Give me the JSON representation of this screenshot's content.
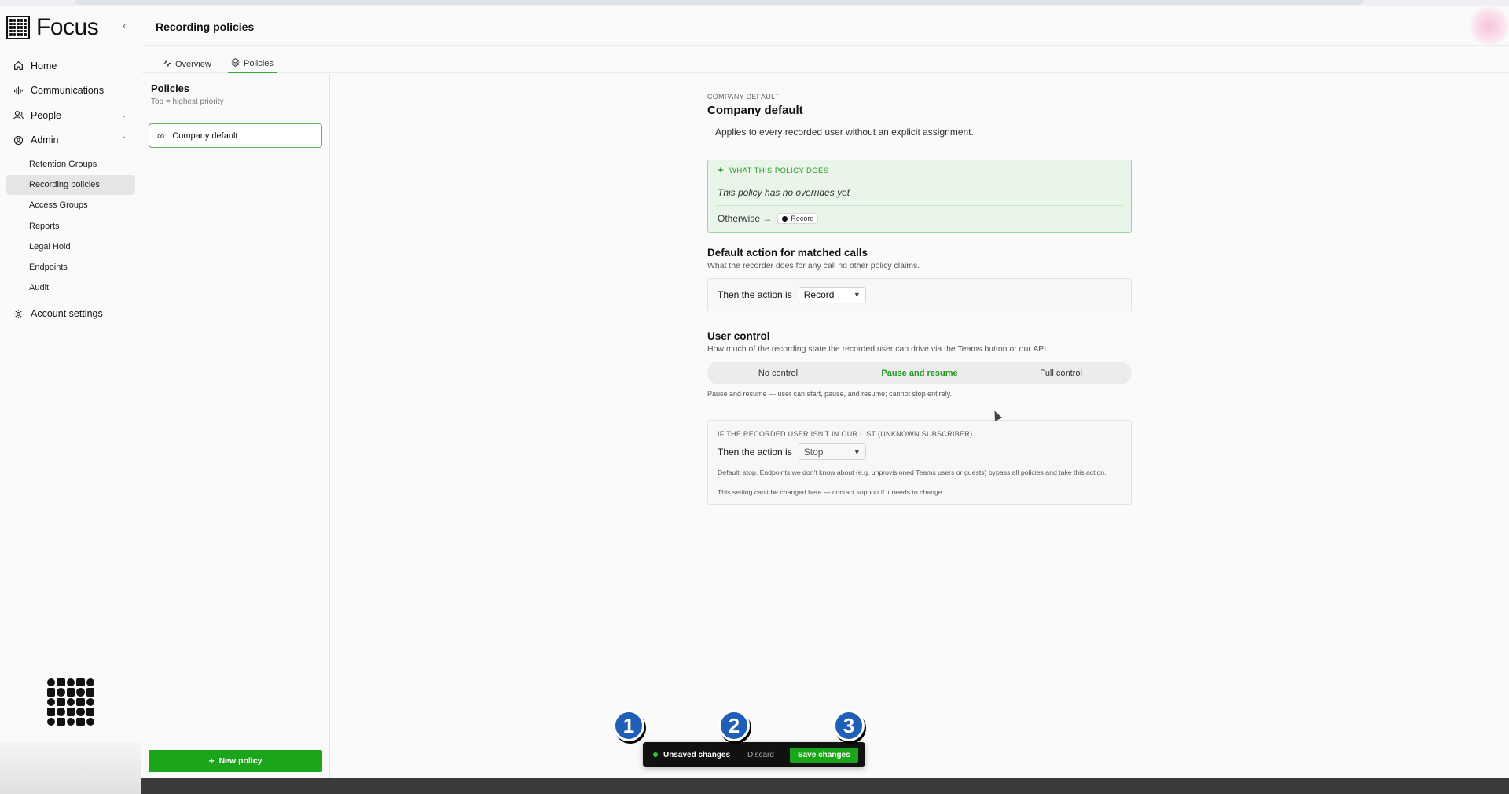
{
  "app": {
    "name": "Focus"
  },
  "sidebar": {
    "collapse_icon": "chevron-left-icon",
    "items": [
      {
        "label": "Home",
        "icon": "home-icon"
      },
      {
        "label": "Communications",
        "icon": "waveform-icon"
      },
      {
        "label": "People",
        "icon": "people-icon"
      },
      {
        "label": "Admin",
        "icon": "shield-icon"
      }
    ],
    "admin_sub": [
      {
        "label": "Retention Groups"
      },
      {
        "label": "Recording policies",
        "active": true
      },
      {
        "label": "Access Groups"
      },
      {
        "label": "Reports"
      },
      {
        "label": "Legal Hold"
      },
      {
        "label": "Endpoints"
      },
      {
        "label": "Audit"
      }
    ],
    "account": {
      "label": "Account settings",
      "icon": "gear-icon"
    }
  },
  "header": {
    "title": "Recording policies"
  },
  "tabs": [
    {
      "label": "Overview",
      "icon": "activity-icon"
    },
    {
      "label": "Policies",
      "icon": "layers-icon",
      "active": true
    }
  ],
  "policies": {
    "title": "Policies",
    "subtitle": "Top = highest priority",
    "items": [
      {
        "label": "Company default",
        "icon": "infinity-icon"
      }
    ],
    "new_button": "New policy"
  },
  "main": {
    "kicker": "COMPANY DEFAULT",
    "title": "Company default",
    "description": "Applies to every recorded user without an explicit assignment.",
    "summary": {
      "heading": "WHAT THIS POLICY DOES",
      "empty": "This policy has no overrides yet",
      "otherwise": "Otherwise →",
      "otherwise_value": "Record"
    },
    "default_action": {
      "title": "Default action for matched calls",
      "subtitle": "What the recorder does for any call no other policy claims.",
      "prefix": "Then the action is",
      "value": "Record"
    },
    "user_control": {
      "title": "User control",
      "subtitle": "How much of the recording state the recorded user can drive via the Teams button or our API.",
      "options": [
        "No control",
        "Pause and resume",
        "Full control"
      ],
      "selected": "Pause and resume",
      "note": "Pause and resume — user can start, pause, and resume; cannot stop entirely."
    },
    "unknown": {
      "heading": "IF THE RECORDED USER ISN'T IN OUR LIST (UNKNOWN SUBSCRIBER)",
      "prefix": "Then the action is",
      "value": "Stop",
      "note": "Default: stop. Endpoints we don't know about (e.g. unprovisioned Teams users or guests) bypass all policies and take this action.",
      "note2": "This setting can't be changed here — contact support if it needs to change."
    }
  },
  "savebar": {
    "status": "Unsaved changes",
    "discard": "Discard",
    "save": "Save changes",
    "markers": [
      "1",
      "2",
      "3"
    ]
  },
  "colors": {
    "accent": "#1aa51a",
    "marker": "#1f5fb5"
  }
}
